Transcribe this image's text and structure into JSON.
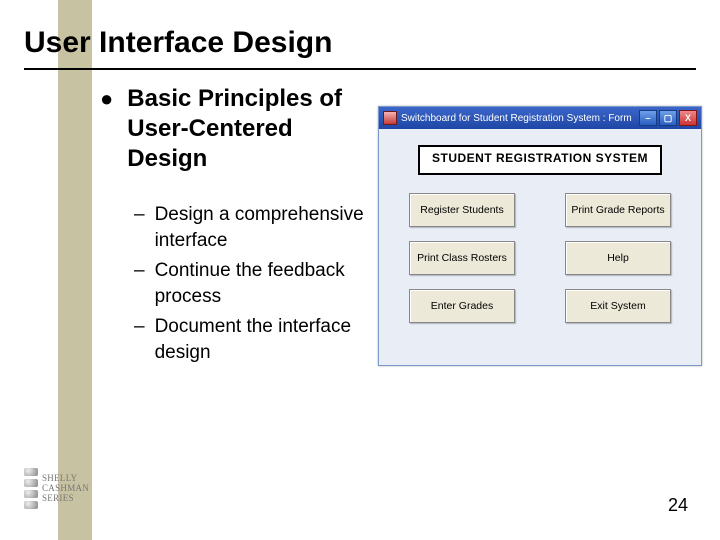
{
  "title": "User Interface Design",
  "main_bullet": "Basic Principles of User-Centered Design",
  "sub_bullets": [
    "Design a comprehensive interface",
    "Continue the feedback process",
    "Document the interface design"
  ],
  "figure": {
    "window_title": "Switchboard for Student Registration System : Form",
    "system_heading": "STUDENT REGISTRATION SYSTEM",
    "buttons": [
      "Register Students",
      "Print Grade Reports",
      "Print Class Rosters",
      "Help",
      "Enter Grades",
      "Exit System"
    ],
    "win_controls": {
      "min": "–",
      "max": "▢",
      "close": "X"
    }
  },
  "page_number": "24",
  "logo": {
    "line1": "SHELLY",
    "line2": "CASHMAN",
    "line3": "SERIES"
  }
}
